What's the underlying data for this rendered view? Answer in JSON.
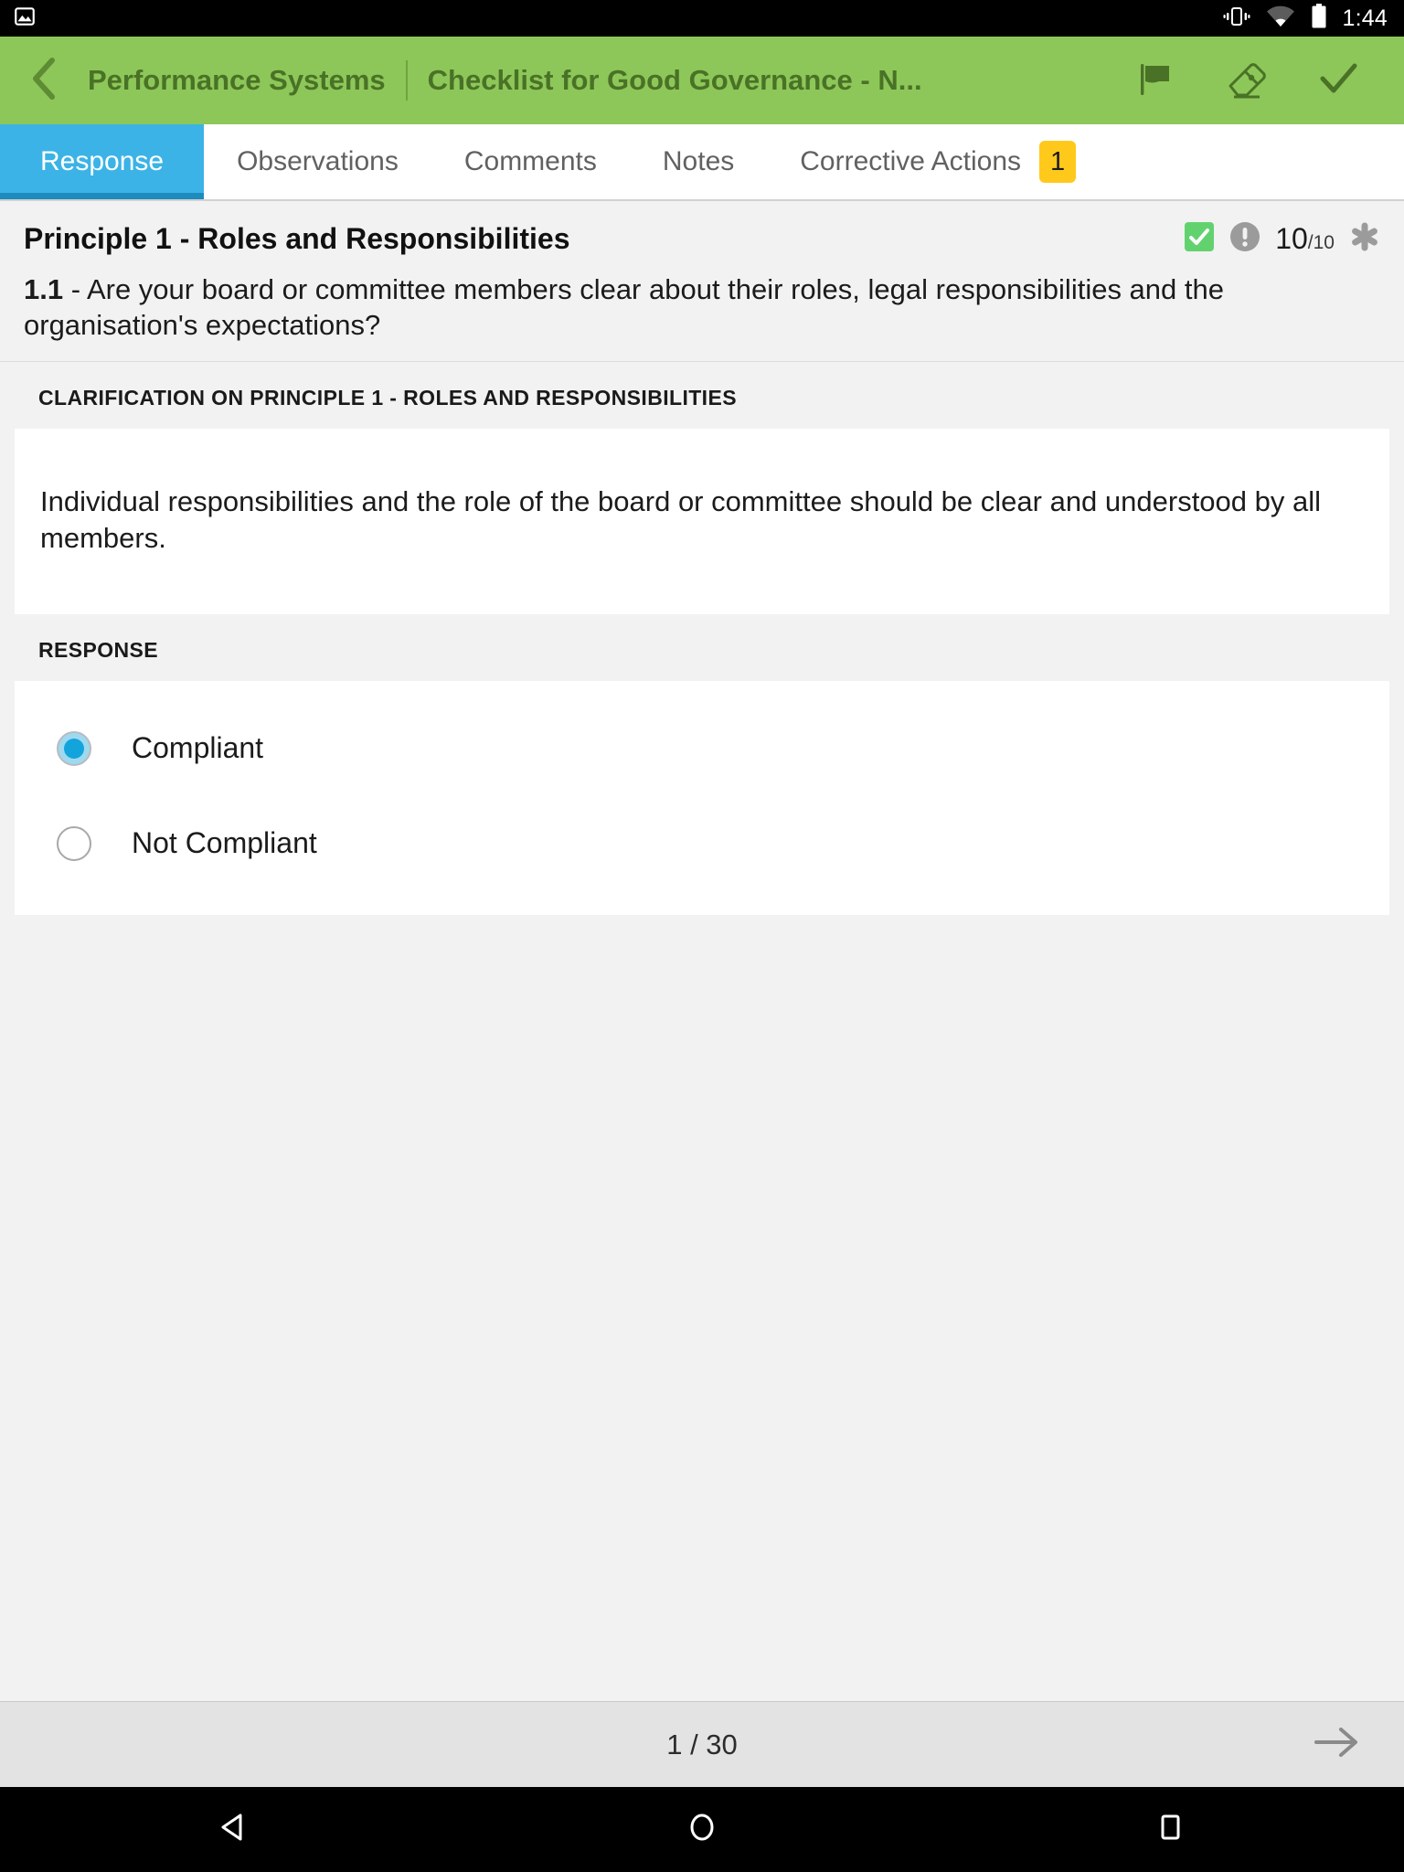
{
  "status_bar": {
    "notification_icon": "image-icon",
    "vibrate_icon": "vibrate-icon",
    "wifi_icon": "wifi-icon",
    "battery_icon": "battery-icon",
    "time": "1:44"
  },
  "header": {
    "back_icon": "chevron-left-icon",
    "title": "Performance Systems",
    "subtitle": "Checklist for Good Governance - N...",
    "actions": [
      {
        "name": "flag-icon",
        "label": "Flag"
      },
      {
        "name": "eraser-icon",
        "label": "Erase"
      },
      {
        "name": "check-icon",
        "label": "Complete"
      }
    ],
    "background_color": "#8DC759",
    "text_color": "#4A7226"
  },
  "tabs": {
    "active_index": 0,
    "active_color": "#3BB3E6",
    "indicator_color": "#1E8BBE",
    "badge_color": "#FFC91B",
    "items": [
      {
        "label": "Response",
        "badge": null
      },
      {
        "label": "Observations",
        "badge": null
      },
      {
        "label": "Comments",
        "badge": null
      },
      {
        "label": "Notes",
        "badge": null
      },
      {
        "label": "Corrective Actions",
        "badge": "1"
      }
    ]
  },
  "question": {
    "principle_title": "Principle 1 - Roles and Responsibilities",
    "status_check_icon": "checkbox-checked-icon",
    "status_check_color": "#62D26F",
    "info_icon": "exclamation-circle-icon",
    "score": "10",
    "score_denominator": "/10",
    "asterisk_icon": "asterisk-icon",
    "number": "1.1",
    "text": " - Are your board or committee members clear about their roles, legal responsibilities and the organisation's expectations?"
  },
  "clarification": {
    "label": "CLARIFICATION ON PRINCIPLE 1 - ROLES AND RESPONSIBILITIES",
    "body": "Individual responsibilities and the role of the board or committee should be clear and understood by all members."
  },
  "response": {
    "label": "RESPONSE",
    "selected_color": "#13A4DC",
    "options": [
      {
        "label": "Compliant",
        "selected": true
      },
      {
        "label": "Not Compliant",
        "selected": false
      }
    ]
  },
  "pager": {
    "text": "1 / 30",
    "next_icon": "arrow-right-icon"
  },
  "nav_bar": {
    "back_icon": "nav-back-triangle-icon",
    "home_icon": "nav-home-circle-icon",
    "recents_icon": "nav-recents-square-icon"
  }
}
